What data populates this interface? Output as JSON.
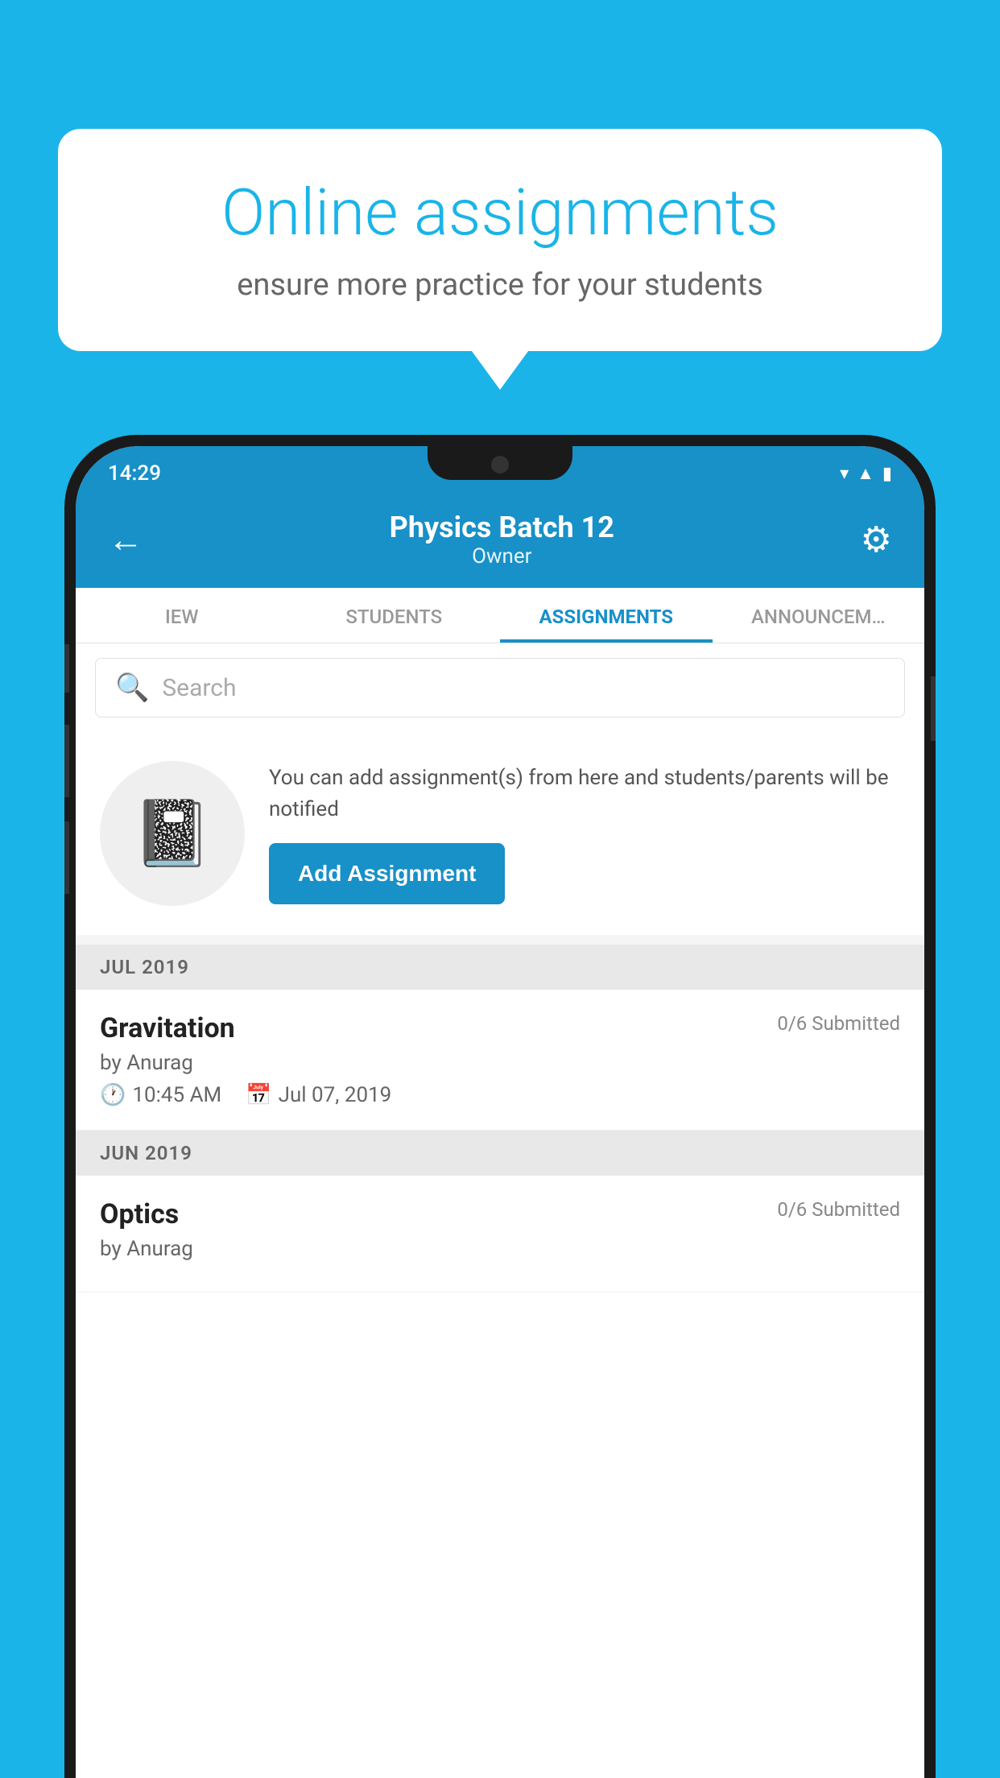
{
  "background_color": "#1ab4e8",
  "speech_bubble": {
    "title": "Online assignments",
    "subtitle": "ensure more practice for your students"
  },
  "phone": {
    "status_bar": {
      "time": "14:29",
      "icons": [
        "wifi",
        "signal",
        "battery"
      ]
    },
    "header": {
      "title": "Physics Batch 12",
      "subtitle": "Owner",
      "back_label": "←",
      "settings_label": "⚙"
    },
    "tabs": [
      {
        "label": "IEW",
        "active": false
      },
      {
        "label": "STUDENTS",
        "active": false
      },
      {
        "label": "ASSIGNMENTS",
        "active": true
      },
      {
        "label": "ANNOUNCEM…",
        "active": false
      }
    ],
    "search": {
      "placeholder": "Search"
    },
    "add_assignment_section": {
      "description": "You can add assignment(s) from here and students/parents will be notified",
      "button_label": "Add Assignment"
    },
    "assignment_groups": [
      {
        "month": "JUL 2019",
        "assignments": [
          {
            "name": "Gravitation",
            "submitted": "0/6 Submitted",
            "by": "by Anurag",
            "time": "10:45 AM",
            "date": "Jul 07, 2019"
          }
        ]
      },
      {
        "month": "JUN 2019",
        "assignments": [
          {
            "name": "Optics",
            "submitted": "0/6 Submitted",
            "by": "by Anurag",
            "time": "",
            "date": ""
          }
        ]
      }
    ]
  }
}
